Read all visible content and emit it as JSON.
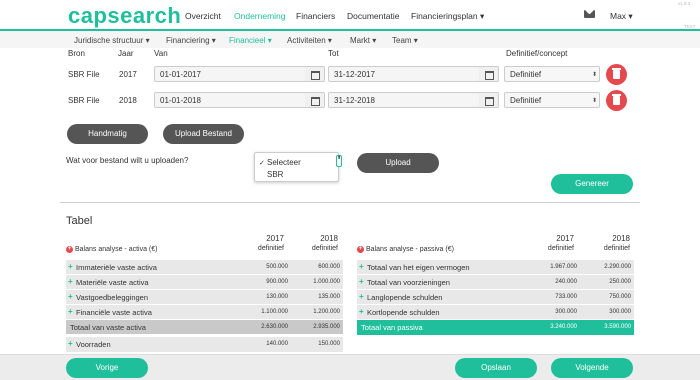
{
  "brand": "capsearch",
  "top_nav": [
    {
      "label": "Overzicht",
      "active": false
    },
    {
      "label": "Onderneming",
      "active": true
    },
    {
      "label": "Financiers",
      "active": false
    },
    {
      "label": "Documentatie",
      "active": false
    },
    {
      "label": "Financieringsplan ▾",
      "active": false
    }
  ],
  "user_menu": "Max ▾",
  "version_top": "v1.9.3",
  "version_bottom": "TEST",
  "sub_nav": [
    {
      "label": "Juridische structuur ▾",
      "active": false
    },
    {
      "label": "Financiering ▾",
      "active": false
    },
    {
      "label": "Financieel ▾",
      "active": true
    },
    {
      "label": "Activiteiten ▾",
      "active": false
    },
    {
      "label": "Markt ▾",
      "active": false
    },
    {
      "label": "Team ▾",
      "active": false
    }
  ],
  "columns": {
    "bron": "Bron",
    "jaar": "Jaar",
    "van": "Van",
    "tot": "Tot",
    "def": "Definitief/concept"
  },
  "sources": [
    {
      "bron": "SBR File",
      "jaar": "2017",
      "van": "01-01-2017",
      "tot": "31-12-2017",
      "status": "Definitief"
    },
    {
      "bron": "SBR File",
      "jaar": "2018",
      "van": "01-01-2018",
      "tot": "31-12-2018",
      "status": "Definitief"
    }
  ],
  "buttons": {
    "handmatig": "Handmatig",
    "upload_bestand": "Upload Bestand",
    "upload": "Upload",
    "genereer": "Genereer",
    "vorige": "Vorige",
    "opslaan": "Opslaan",
    "volgende": "Volgende"
  },
  "upload_question": "Wat voor bestand wilt u uploaden?",
  "dropdown": {
    "options": [
      "Selecteer",
      "SBR"
    ],
    "selected": "Selecteer",
    "check": "✓"
  },
  "tabel_title": "Tabel",
  "activa": {
    "title": "Balans analyse - activa (€)",
    "years": [
      "2017",
      "2018"
    ],
    "sub": "definitief",
    "rows": [
      {
        "label": "Immateriële vaste activa",
        "v1": "500.000",
        "v2": "600.000"
      },
      {
        "label": "Materiële vaste activa",
        "v1": "900.000",
        "v2": "1.000.000"
      },
      {
        "label": "Vastgoedbeleggingen",
        "v1": "130.000",
        "v2": "135.000"
      },
      {
        "label": "Financiële vaste activa",
        "v1": "1.100.000",
        "v2": "1.200.000"
      }
    ],
    "total": {
      "label": "Totaal van vaste activa",
      "v1": "2.630.000",
      "v2": "2.935.000"
    },
    "extra": {
      "label": "Voorraden",
      "v1": "140.000",
      "v2": "150.000"
    }
  },
  "passiva": {
    "title": "Balans analyse - passiva (€)",
    "years": [
      "2017",
      "2018"
    ],
    "sub": "definitief",
    "rows": [
      {
        "label": "Totaal van het eigen vermogen",
        "v1": "1.967.000",
        "v2": "2.290.000"
      },
      {
        "label": "Totaal van voorzieningen",
        "v1": "240.000",
        "v2": "250.000"
      },
      {
        "label": "Langlopende schulden",
        "v1": "733.000",
        "v2": "750.000"
      },
      {
        "label": "Kortlopende schulden",
        "v1": "300.000",
        "v2": "300.000"
      }
    ],
    "total": {
      "label": "Totaal van passiva",
      "v1": "3.240.000",
      "v2": "3.590.000"
    }
  },
  "colors": {
    "accent": "#1fbf9c",
    "danger": "#e5484d",
    "dark_button": "#555555"
  }
}
